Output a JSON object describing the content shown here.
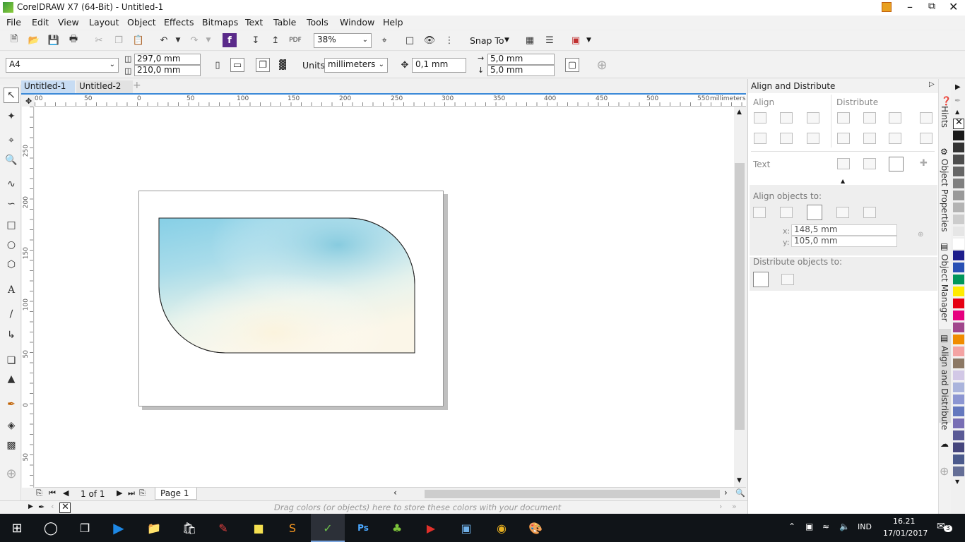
{
  "app": {
    "title": "CorelDRAW X7 (64-Bit) - Untitled-1"
  },
  "menu": [
    "File",
    "Edit",
    "View",
    "Layout",
    "Object",
    "Effects",
    "Bitmaps",
    "Text",
    "Table",
    "Tools",
    "Window",
    "Help"
  ],
  "toolbar1": {
    "zoom": "38%",
    "snap_label": "Snap To"
  },
  "toolbar2": {
    "page_size": "A4",
    "width": "297,0 mm",
    "height": "210,0 mm",
    "units_label": "Units:",
    "units_value": "millimeters",
    "nudge": "0,1 mm",
    "dup_x": "5,0 mm",
    "dup_y": "5,0 mm"
  },
  "tabs": [
    "Untitled-1",
    "Untitled-2"
  ],
  "ruler": {
    "unit": "millimeters",
    "h_ticks": [
      "00",
      "50",
      "0",
      "50",
      "100",
      "150",
      "200",
      "250",
      "300",
      "350",
      "400",
      "450",
      "500",
      "550"
    ],
    "v_ticks": [
      "250",
      "200",
      "150",
      "100",
      "50",
      "0",
      "50"
    ]
  },
  "page_nav": {
    "count": "1 of 1",
    "page_tab": "Page 1"
  },
  "status": {
    "hint": "Drag colors (or objects) here to store these colors with your document"
  },
  "docker": {
    "title": "Align and Distribute",
    "align": "Align",
    "distribute": "Distribute",
    "text": "Text",
    "align_to": "Align objects to:",
    "x_label": "x:",
    "x_value": "148,5 mm",
    "y_label": "y:",
    "y_value": "105,0 mm",
    "distribute_to": "Distribute objects to:"
  },
  "vtabs": [
    "Hints",
    "Object Properties",
    "Object Manager",
    "Align and Distribute"
  ],
  "palette": [
    "#ffffff",
    "#1a1a1a",
    "#333333",
    "#4d4d4d",
    "#666666",
    "#808080",
    "#999999",
    "#b3b3b3",
    "#cccccc",
    "#e6e6e6",
    "#ffffff",
    "#1e1e8c",
    "#2850b4",
    "#00965a",
    "#ffeb00",
    "#e60012",
    "#e6007e",
    "#a0468c",
    "#f08c00",
    "#f4a3a3",
    "#8c7864",
    "#d2c8e6",
    "#aab4dc",
    "#8c96d2",
    "#6478be",
    "#786eb4",
    "#5a5a96",
    "#46467d",
    "#4b5a8c",
    "#646e96"
  ],
  "taskbar": {
    "lang": "IND",
    "time": "16.21",
    "date": "17/01/2017",
    "notif": "3"
  }
}
